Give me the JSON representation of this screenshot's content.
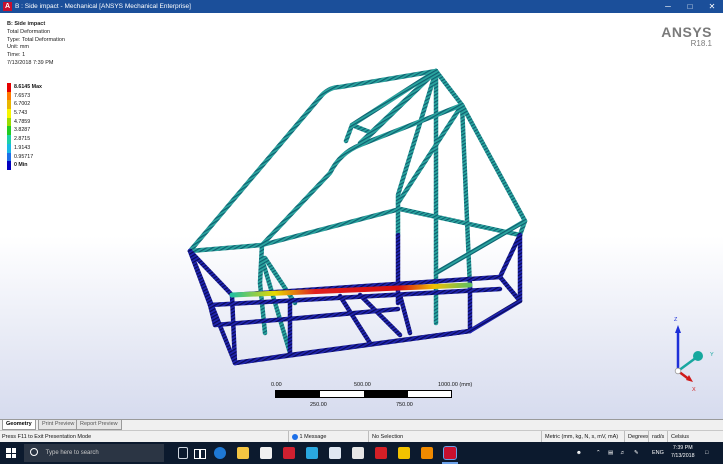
{
  "window": {
    "title": "B : Side impact - Mechanical [ANSYS Mechanical Enterprise]",
    "minimize_glyph": "─",
    "maximize_glyph": "□",
    "close_glyph": "✕"
  },
  "info": {
    "name": "B: Side impact",
    "type_line": "Total Deformation",
    "type_detail": "Type: Total Deformation",
    "unit": "Unit: mm",
    "time": "Time: 1",
    "date": "7/13/2018 7:39 PM"
  },
  "legend": [
    {
      "label": "8.6145 Max",
      "color": "#e60000",
      "bold": true
    },
    {
      "label": "7.6573",
      "color": "#ff7a00",
      "bold": false
    },
    {
      "label": "6.7002",
      "color": "#e9b600",
      "bold": false
    },
    {
      "label": "5.743",
      "color": "#f7f700",
      "bold": false
    },
    {
      "label": "4.7859",
      "color": "#9cdc00",
      "bold": false
    },
    {
      "label": "3.8287",
      "color": "#22cc22",
      "bold": false
    },
    {
      "label": "2.8715",
      "color": "#1dd0a8",
      "bold": false
    },
    {
      "label": "1.9143",
      "color": "#18b8e6",
      "bold": false
    },
    {
      "label": "0.95717",
      "color": "#1d6fe8",
      "bold": false
    },
    {
      "label": "0 Min",
      "color": "#0000c0",
      "bold": true
    }
  ],
  "brand": {
    "name": "ANSYS",
    "version": "R18.1"
  },
  "scale_bar": {
    "top_labels": [
      "0.00",
      "500.00",
      "1000.00 (mm)"
    ],
    "bottom_labels": [
      "250.00",
      "750.00"
    ]
  },
  "triad": {
    "z": "Z",
    "y": "Y",
    "x": "X"
  },
  "tabs": [
    "Geometry",
    "Print Preview",
    "Report Preview"
  ],
  "status": {
    "hint": "Press F11 to Exit Presentation Mode",
    "messages": "1 Message",
    "selection": "No Selection",
    "units": "Metric (mm, kg, N, s, mV, mA)",
    "angle": "Degrees",
    "rate": "rad/s",
    "temp": "Celsius"
  },
  "taskbar": {
    "search_placeholder": "Type here to search",
    "time": "7:39 PM",
    "date": "7/13/2018",
    "lang": "ENG"
  },
  "colors": {
    "frame_main": "#1c9c98",
    "frame_low": "#1a1a8c",
    "frame_max": "#d01010"
  }
}
